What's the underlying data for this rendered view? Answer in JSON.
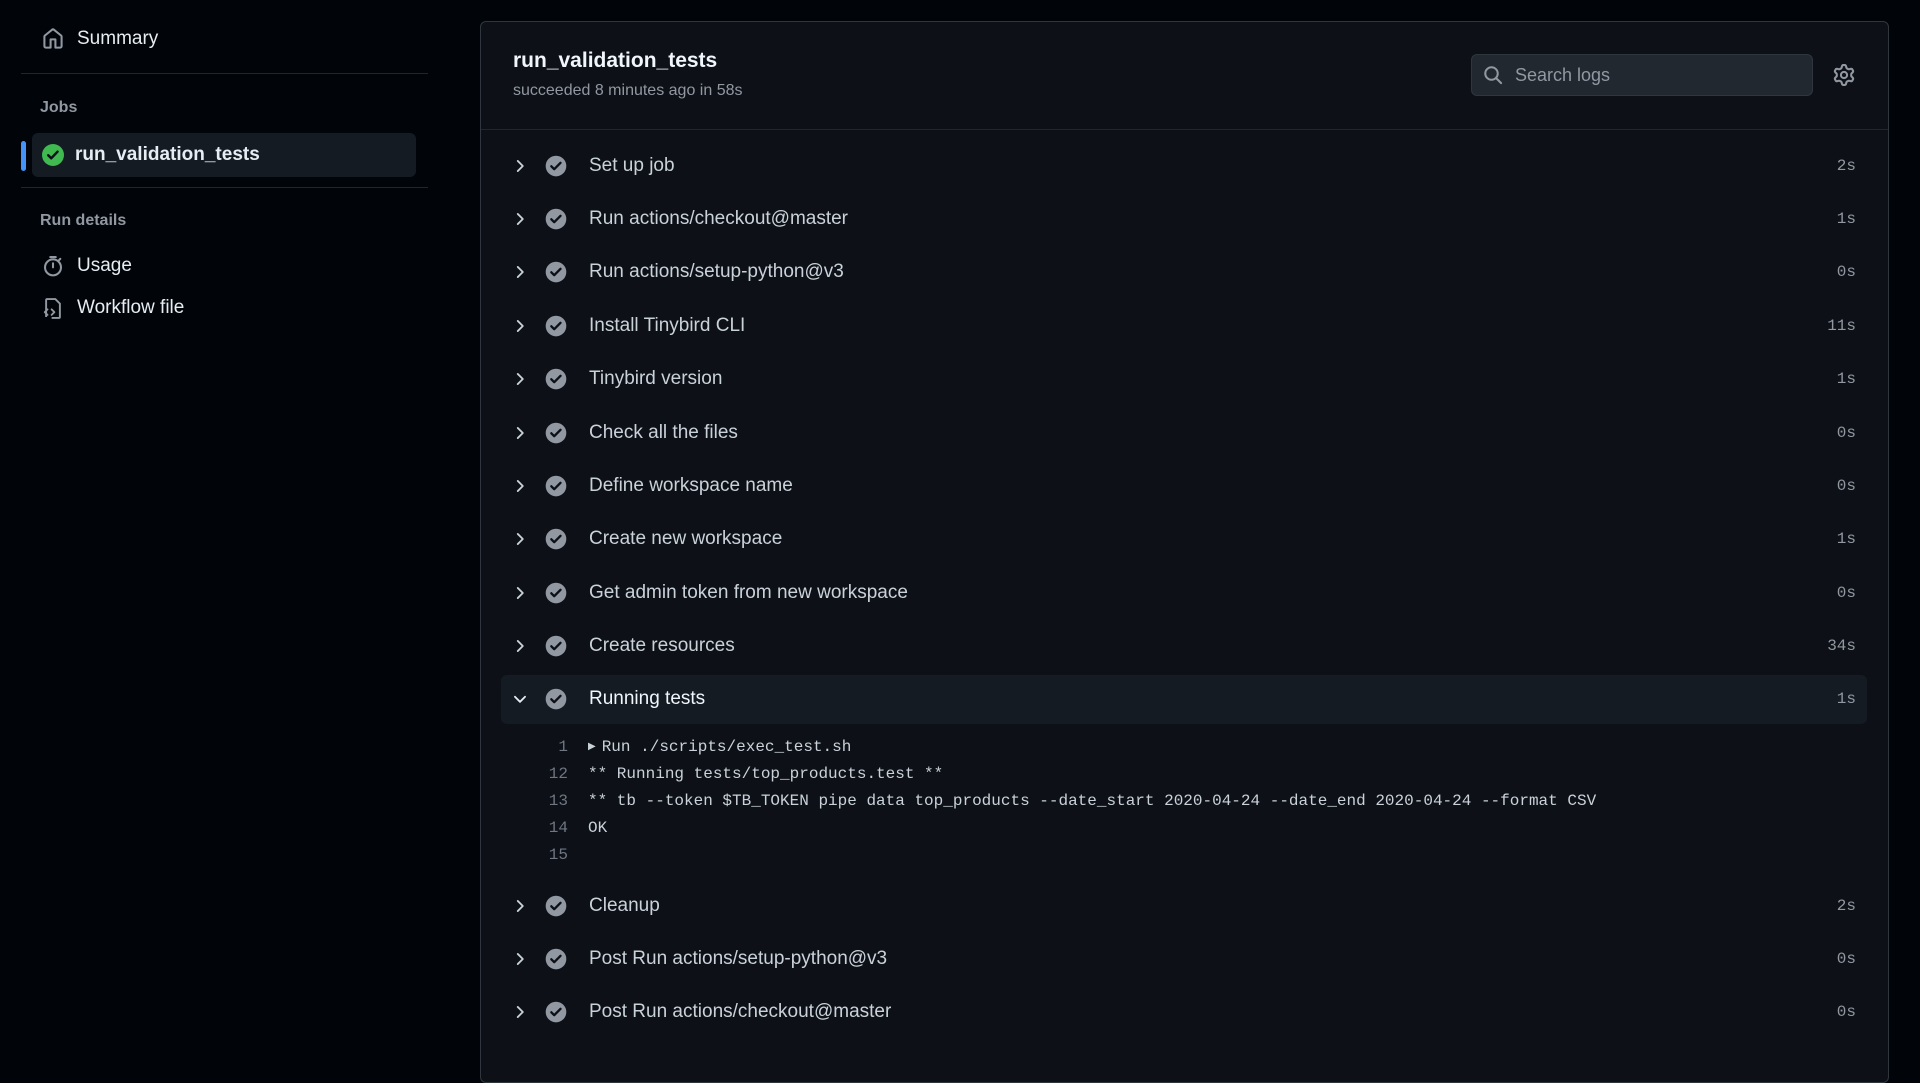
{
  "sidebar": {
    "summary_label": "Summary",
    "jobs_heading": "Jobs",
    "active_job": "run_validation_tests",
    "run_details_heading": "Run details",
    "usage_label": "Usage",
    "workflow_label": "Workflow file"
  },
  "job": {
    "title": "run_validation_tests",
    "subtitle": "succeeded 8 minutes ago in 58s",
    "search_placeholder": "Search logs"
  },
  "steps_before": [
    {
      "name": "Set up job",
      "duration": "2s"
    },
    {
      "name": "Run actions/checkout@master",
      "duration": "1s"
    },
    {
      "name": "Run actions/setup-python@v3",
      "duration": "0s"
    },
    {
      "name": "Install Tinybird CLI",
      "duration": "11s"
    },
    {
      "name": "Tinybird version",
      "duration": "1s"
    },
    {
      "name": "Check all the files",
      "duration": "0s"
    },
    {
      "name": "Define workspace name",
      "duration": "0s"
    },
    {
      "name": "Create new workspace",
      "duration": "1s"
    },
    {
      "name": "Get admin token from new workspace",
      "duration": "0s"
    },
    {
      "name": "Create resources",
      "duration": "34s"
    }
  ],
  "expanded_step": {
    "name": "Running tests",
    "duration": "1s"
  },
  "log_lines": [
    {
      "num": "1",
      "text": "Run ./scripts/exec_test.sh",
      "collapsible": true
    },
    {
      "num": "12",
      "text": "** Running tests/top_products.test **"
    },
    {
      "num": "13",
      "text": "** tb --token $TB_TOKEN pipe data top_products --date_start 2020-04-24 --date_end 2020-04-24 --format CSV"
    },
    {
      "num": "14",
      "text": "OK"
    },
    {
      "num": "15",
      "text": ""
    }
  ],
  "steps_after": [
    {
      "name": "Cleanup",
      "duration": "2s"
    },
    {
      "name": "Post Run actions/setup-python@v3",
      "duration": "0s"
    },
    {
      "name": "Post Run actions/checkout@master",
      "duration": "0s"
    }
  ],
  "colors": {
    "success": "#3fb950",
    "accent": "#4493f8",
    "step_check": "#9198a1"
  }
}
